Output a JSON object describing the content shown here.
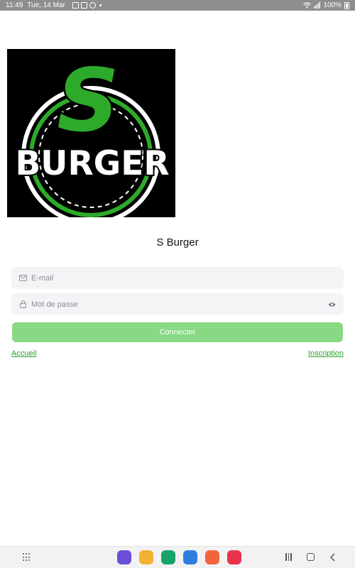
{
  "status_bar": {
    "time": "11:49",
    "date": "Tue, 14 Mar",
    "battery": "100%",
    "icons": [
      "gallery-icon",
      "nfc-icon",
      "sync-icon",
      "wifi-icon",
      "signal-icon",
      "battery-icon"
    ]
  },
  "logo": {
    "letter": "S",
    "word": "BURGER"
  },
  "app_title": "S Burger",
  "email": {
    "placeholder": "E-mail",
    "value": ""
  },
  "password": {
    "placeholder": "Mot de passe",
    "value": ""
  },
  "connect_label": "Connecter",
  "links": {
    "home": "Accueil",
    "signup": "Inscription"
  },
  "dock_apps": [
    {
      "name": "internet-app-icon",
      "color": "#6b4fd8"
    },
    {
      "name": "files-app-icon",
      "color": "#f2b233"
    },
    {
      "name": "phone-app-icon",
      "color": "#19a36a"
    },
    {
      "name": "messages-app-icon",
      "color": "#2f7de1"
    },
    {
      "name": "contacts-app-icon",
      "color": "#f2643e"
    },
    {
      "name": "camera-app-icon",
      "color": "#e8334a"
    }
  ],
  "colors": {
    "accent": "#2aa12a",
    "button": "#88d884",
    "logo_green": "#2eaa2a",
    "status_bar": "#8e8e8e"
  }
}
